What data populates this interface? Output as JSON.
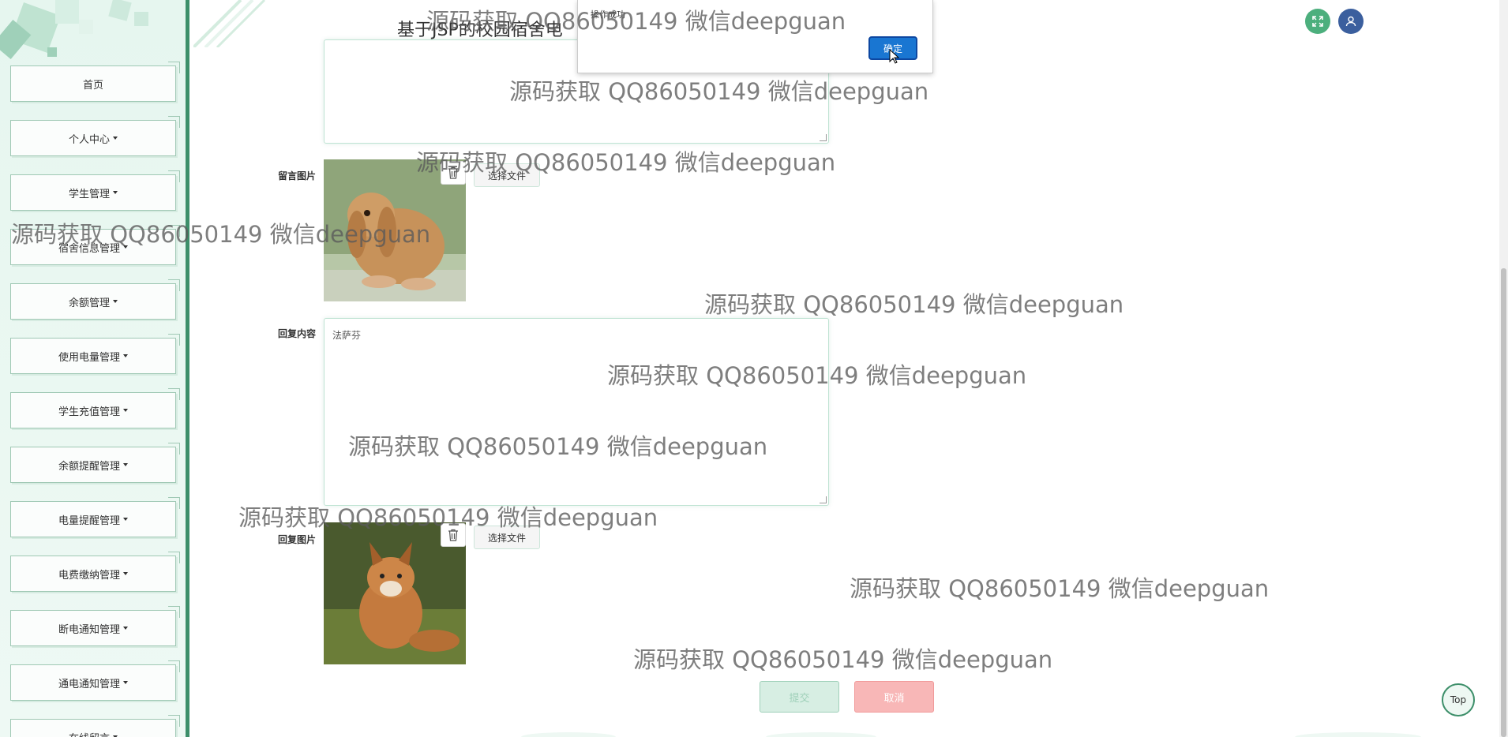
{
  "header": {
    "title": "基于JSP的校园宿舍电"
  },
  "sidebar": {
    "items": [
      {
        "label": "首页",
        "has_caret": false
      },
      {
        "label": "个人中心",
        "has_caret": true
      },
      {
        "label": "学生管理",
        "has_caret": true
      },
      {
        "label": "宿舍信息管理",
        "has_caret": true
      },
      {
        "label": "余额管理",
        "has_caret": true
      },
      {
        "label": "使用电量管理",
        "has_caret": true
      },
      {
        "label": "学生充值管理",
        "has_caret": true
      },
      {
        "label": "余额提醒管理",
        "has_caret": true
      },
      {
        "label": "电量提醒管理",
        "has_caret": true
      },
      {
        "label": "电费缴纳管理",
        "has_caret": true
      },
      {
        "label": "断电通知管理",
        "has_caret": true
      },
      {
        "label": "通电通知管理",
        "has_caret": true
      },
      {
        "label": "在线留言",
        "has_caret": true
      }
    ]
  },
  "form": {
    "message_image_label": "留言图片",
    "reply_content_label": "回复内容",
    "reply_content_value": "法萨芬",
    "reply_image_label": "回复图片",
    "choose_file_label": "选择文件",
    "submit_label": "提交",
    "cancel_label": "取消"
  },
  "dialog": {
    "message": "操作成功",
    "ok_label": "确定"
  },
  "top_button": "Top",
  "icons": {
    "fullscreen": "fullscreen-icon",
    "user": "user-icon",
    "trash": "trash-icon"
  },
  "colors": {
    "accent": "#3d8f6a",
    "sidebar_bg": "#e6f6ef",
    "ok_button": "#1976d2",
    "cancel_button": "#f8b7b7",
    "submit_button": "#d7eee3",
    "user_icon_bg": "#3b5f9e",
    "fullscreen_icon_bg": "#4caf7d"
  },
  "watermark": "源码获取 QQ86050149 微信deepguan"
}
